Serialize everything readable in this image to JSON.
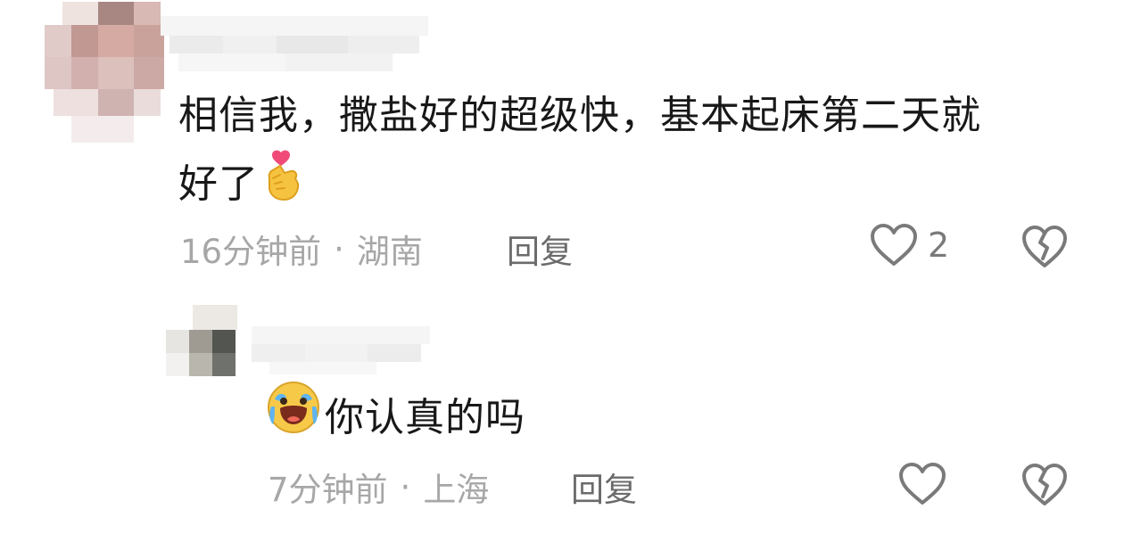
{
  "comment": {
    "text_line1": "相信我，撒盐好的超级快，基本起床第二天就",
    "text_line2": "好了",
    "emoji": "finger-heart-emoji",
    "time": "16分钟前",
    "separator": "·",
    "location": "湖南",
    "reply_label": "回复",
    "like_count": "2"
  },
  "reply": {
    "emoji": "crying-face-emoji",
    "text": "你认真的吗",
    "time": "7分钟前",
    "separator": "·",
    "location": "上海",
    "reply_label": "回复"
  },
  "icons": {
    "like": "heart-outline-icon",
    "dislike": "broken-heart-icon"
  },
  "colors": {
    "text": "#181818",
    "meta": "#a7a7a7",
    "reply": "#6b6b6b",
    "icon": "#7a7a7a"
  }
}
